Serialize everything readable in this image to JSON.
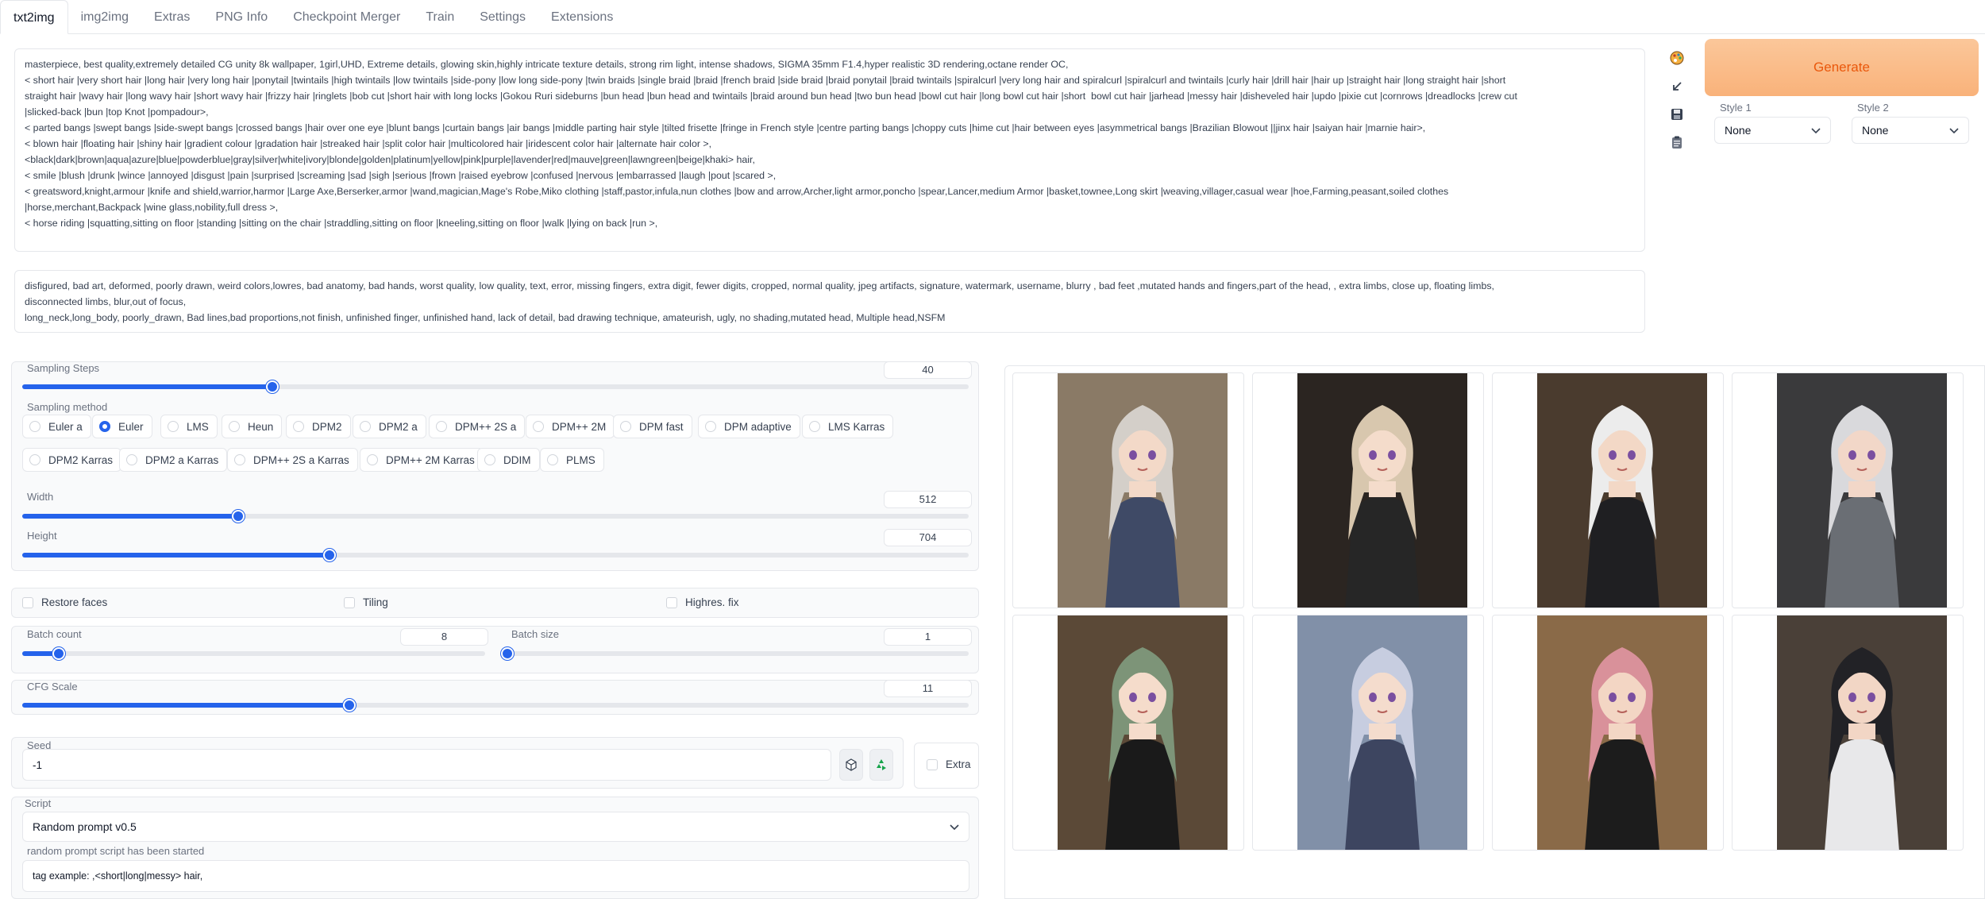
{
  "tabs": [
    "txt2img",
    "img2img",
    "Extras",
    "PNG Info",
    "Checkpoint Merger",
    "Train",
    "Settings",
    "Extensions"
  ],
  "prompt": {
    "positive": "masterpiece, best quality,extremely detailed CG unity 8k wallpaper, 1girl,UHD, Extreme details, glowing skin,highly intricate texture details, strong rim light, intense shadows, SIGMA 35mm F1.4,hyper realistic 3D rendering,octane render OC,\n< short hair |very short hair |long hair |very long hair |ponytail |twintails |high twintails |low twintails |side-pony |low long side-pony |twin braids |single braid |braid |french braid |side braid |braid ponytail |braid twintails |spiralcurl |very long hair and spiralcurl |spiralcurl and twintails |curly hair |drill hair |hair up |straight hair |long straight hair |short\nstraight hair |wavy hair |long wavy hair |short wavy hair |frizzy hair |ringlets |bob cut |short hair with long locks |Gokou Ruri sideburns |bun head |bun head and twintails |braid around bun head |two bun head |bowl cut hair |long bowl cut hair |short  bowl cut hair |jarhead |messy hair |disheveled hair |updo |pixie cut |cornrows |dreadlocks |crew cut\n|slicked-back |bun |top Knot |pompadour>,\n< parted bangs |swept bangs |side-swept bangs |crossed bangs |hair over one eye |blunt bangs |curtain bangs |air bangs |middle parting hair style |tilted frisette |fringe in French style |centre parting bangs |choppy cuts |hime cut |hair between eyes |asymmetrical bangs |Brazilian Blowout ||jinx hair |saiyan hair |marnie hair>,\n< blown hair |floating hair |shiny hair |gradient colour |gradation hair |streaked hair |split color hair |multicolored hair |iridescent color hair |alternate hair color >,\n<black|dark|brown|aqua|azure|blue|powderblue|gray|silver|white|ivory|blonde|golden|platinum|yellow|pink|purple|lavender|red|mauve|green|lawngreen|beige|khaki> hair,\n< smile |blush |drunk |wince |annoyed |disgust |pain |surprised |screaming |sad |sigh |serious |frown |raised eyebrow |confused |nervous |embarrassed |laugh |pout |scared >,\n< greatsword,knight,armour |knife and shield,warrior,harmor |Large Axe,Berserker,armor |wand,magician,Mage's Robe,Miko clothing |staff,pastor,infula,nun clothes |bow and arrow,Archer,light armor,poncho |spear,Lancer,medium Armor |basket,townee,Long skirt |weaving,villager,casual wear |hoe,Farming,peasant,soiled clothes\n|horse,merchant,Backpack |wine glass,nobility,full dress >,\n< horse riding |squatting,sitting on floor |standing |sitting on the chair |straddling,sitting on floor |kneeling,sitting on floor |walk |lying on back |run >,",
    "negative": "disfigured, bad art, deformed, poorly drawn, weird colors,lowres, bad anatomy, bad hands, worst quality, low quality, text, error, missing fingers, extra digit, fewer digits, cropped, normal quality, jpeg artifacts, signature, watermark, username, blurry , bad feet ,mutated hands and fingers,part of the head, , extra limbs, close up, floating limbs,\ndisconnected limbs, blur,out of focus,\nlong_neck,long_body, poorly_drawn, Bad lines,bad proportions,not finish, unfinished finger, unfinished hand, lack of detail, bad drawing technique, amateurish, ugly, no shading,mutated head, Multiple head,NSFM"
  },
  "tools": [
    "palette-icon",
    "arrow-icon",
    "save-icon",
    "clipboard-icon"
  ],
  "generate": {
    "label": "Generate"
  },
  "styles": {
    "style1": {
      "label": "Style 1",
      "value": "None"
    },
    "style2": {
      "label": "Style 2",
      "value": "None"
    }
  },
  "sampling_steps": {
    "label": "Sampling Steps",
    "value": "40",
    "fraction": 0.264
  },
  "sampling_method": {
    "label": "Sampling method",
    "selected": "Euler",
    "options": [
      "Euler a",
      "Euler",
      "LMS",
      "Heun",
      "DPM2",
      "DPM2 a",
      "DPM++ 2S a",
      "DPM++ 2M",
      "DPM fast",
      "DPM adaptive",
      "LMS Karras",
      "DPM2 Karras",
      "DPM2 a Karras",
      "DPM++ 2S a Karras",
      "DPM++ 2M Karras",
      "DDIM",
      "PLMS"
    ]
  },
  "width": {
    "label": "Width",
    "value": "512",
    "fraction": 0.228
  },
  "height": {
    "label": "Height",
    "value": "704",
    "fraction": 0.325
  },
  "checks": {
    "restore_faces": "Restore faces",
    "tiling": "Tiling",
    "highres_fix": "Highres. fix"
  },
  "batch_count": {
    "label": "Batch count",
    "value": "8",
    "fraction": 0.079
  },
  "batch_size": {
    "label": "Batch size",
    "value": "1",
    "fraction": 0.0
  },
  "cfg_scale": {
    "label": "CFG Scale",
    "value": "11",
    "fraction": 0.346
  },
  "seed": {
    "label": "Seed",
    "value": "-1"
  },
  "extra": {
    "label": "Extra"
  },
  "script": {
    "label": "Script",
    "value": "Random prompt v0.5"
  },
  "random_prompt": {
    "label": "random prompt script has been started",
    "value": "tag example:  ,<short|long|messy> hair,"
  },
  "gallery": [
    {
      "hair": "#d4cfc9",
      "outfit": "#3f4a66",
      "bg": "#8a7a66",
      "skin": "#f3d9c8"
    },
    {
      "hair": "#d8c7ae",
      "outfit": "#262626",
      "bg": "#2b2521",
      "skin": "#f4dccb"
    },
    {
      "hair": "#ececec",
      "outfit": "#1f1f22",
      "bg": "#4a3b2e",
      "skin": "#f3d8c6"
    },
    {
      "hair": "#d9d9dc",
      "outfit": "#6a6e74",
      "bg": "#3a3a3c",
      "skin": "#f2d7c8"
    },
    {
      "hair": "#7d9478",
      "outfit": "#1a1a1a",
      "bg": "#5b4937",
      "skin": "#f5dccb"
    },
    {
      "hair": "#c7cde0",
      "outfit": "#3d4560",
      "bg": "#8190a8",
      "skin": "#f4dccd"
    },
    {
      "hair": "#d9919a",
      "outfit": "#1c1c1c",
      "bg": "#8a6a48",
      "skin": "#f3d6c4"
    },
    {
      "hair": "#222226",
      "outfit": "#e8e8ea",
      "bg": "#4a4038",
      "skin": "#f2d6c5"
    }
  ]
}
